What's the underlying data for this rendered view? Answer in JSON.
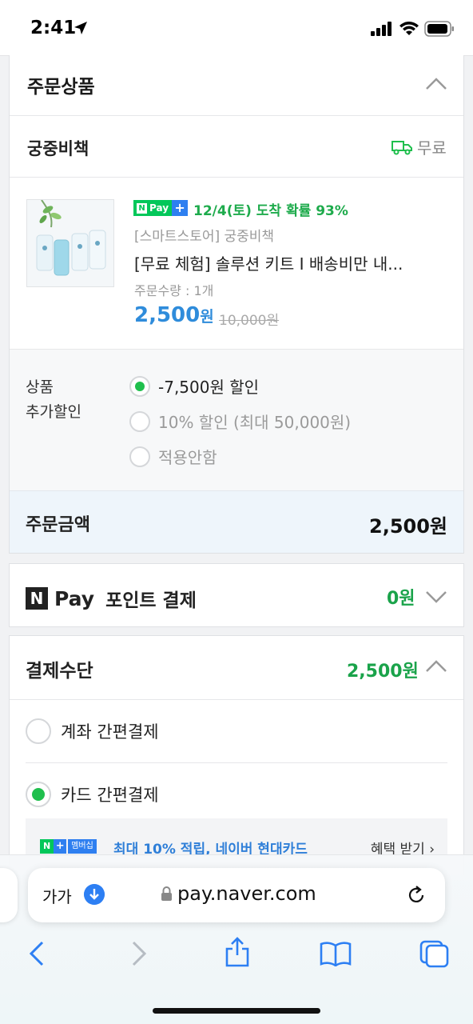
{
  "status_bar": {
    "time": "2:41"
  },
  "order_products": {
    "title": "주문상품",
    "seller": "궁중비책",
    "shipping": "무료",
    "product": {
      "npay_badge": "Pay",
      "delivery_info": "12/4(토) 도착 확률 93%",
      "store": "[스마트스토어] 궁중비책",
      "name": "[무료 체험] 솔루션 키트 I 배송비만 내...",
      "quantity": "주문수량 : 1개",
      "price": "2,500",
      "price_unit": "원",
      "original_price": "10,000원"
    },
    "discount": {
      "label_line1": "상품",
      "label_line2": "추가할인",
      "options": [
        {
          "label": "-7,500원 할인",
          "selected": true
        },
        {
          "label": "10% 할인 (최대 50,000원)",
          "selected": false
        },
        {
          "label": "적용안함",
          "selected": false
        }
      ]
    },
    "order_total": {
      "label": "주문금액",
      "value": "2,500원"
    }
  },
  "npay_point": {
    "logo_letter": "N",
    "logo_text": "Pay",
    "label": "포인트 결제",
    "value": "0원"
  },
  "payment_method": {
    "title": "결제수단",
    "value": "2,500원",
    "options": [
      {
        "label": "계좌 간편결제",
        "selected": false
      },
      {
        "label": "카드 간편결제",
        "selected": true
      }
    ],
    "benefit": {
      "badge_n": "N",
      "badge_plus": "+",
      "badge_member": "멤버십",
      "text": "최대 10% 적립, 네이버 현대카드",
      "link": "혜택 받기"
    }
  },
  "browser": {
    "text_size_label": "가가",
    "url": "pay.naver.com"
  },
  "colors": {
    "green": "#1aa34a",
    "blue_price": "#2f8cdb",
    "npay_green": "#03c75a",
    "ios_blue": "#2d7ff3"
  }
}
